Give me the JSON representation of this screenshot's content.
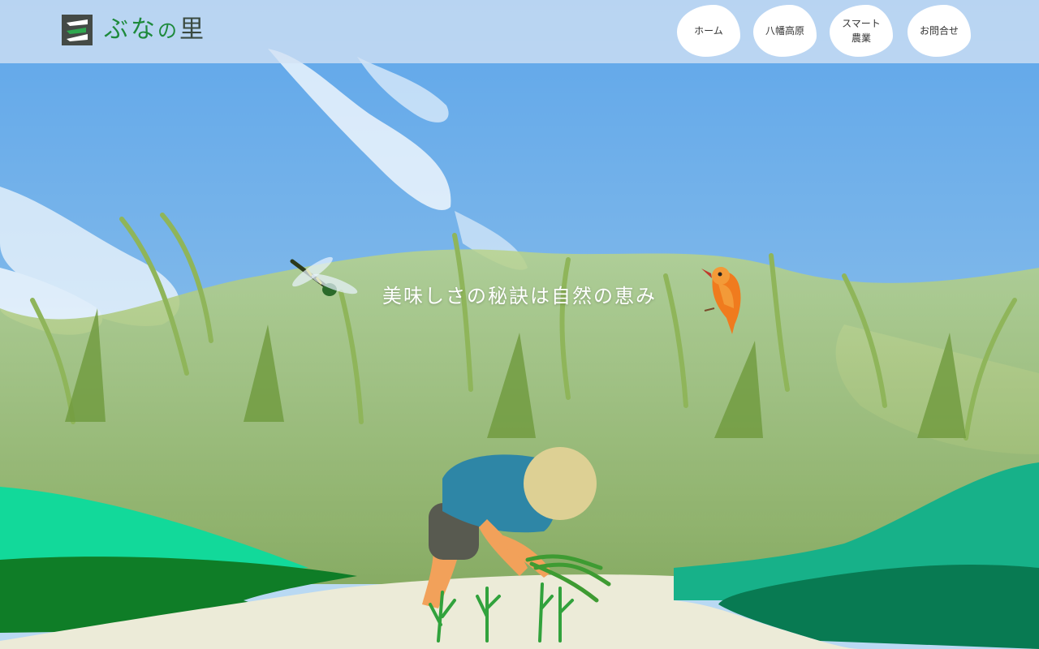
{
  "header": {
    "logo_text": "ぶなの里",
    "logo_text_prefix": "ぶな",
    "logo_text_mid": "の",
    "logo_text_suffix": "里",
    "brand_color": "#1e8a3c"
  },
  "nav": {
    "items": [
      {
        "label": "ホーム"
      },
      {
        "label": "八幡高原"
      },
      {
        "label": "スマート\n農業"
      },
      {
        "label": "お問合せ"
      }
    ]
  },
  "hero": {
    "tagline": "美味しさの秘訣は自然の恵み",
    "colors": {
      "sky": "#7fb6e8",
      "rice": "#9bbf62",
      "hill_light": "#19b48a",
      "hill_dark": "#0f7d3a",
      "path": "#ecebd8"
    }
  }
}
